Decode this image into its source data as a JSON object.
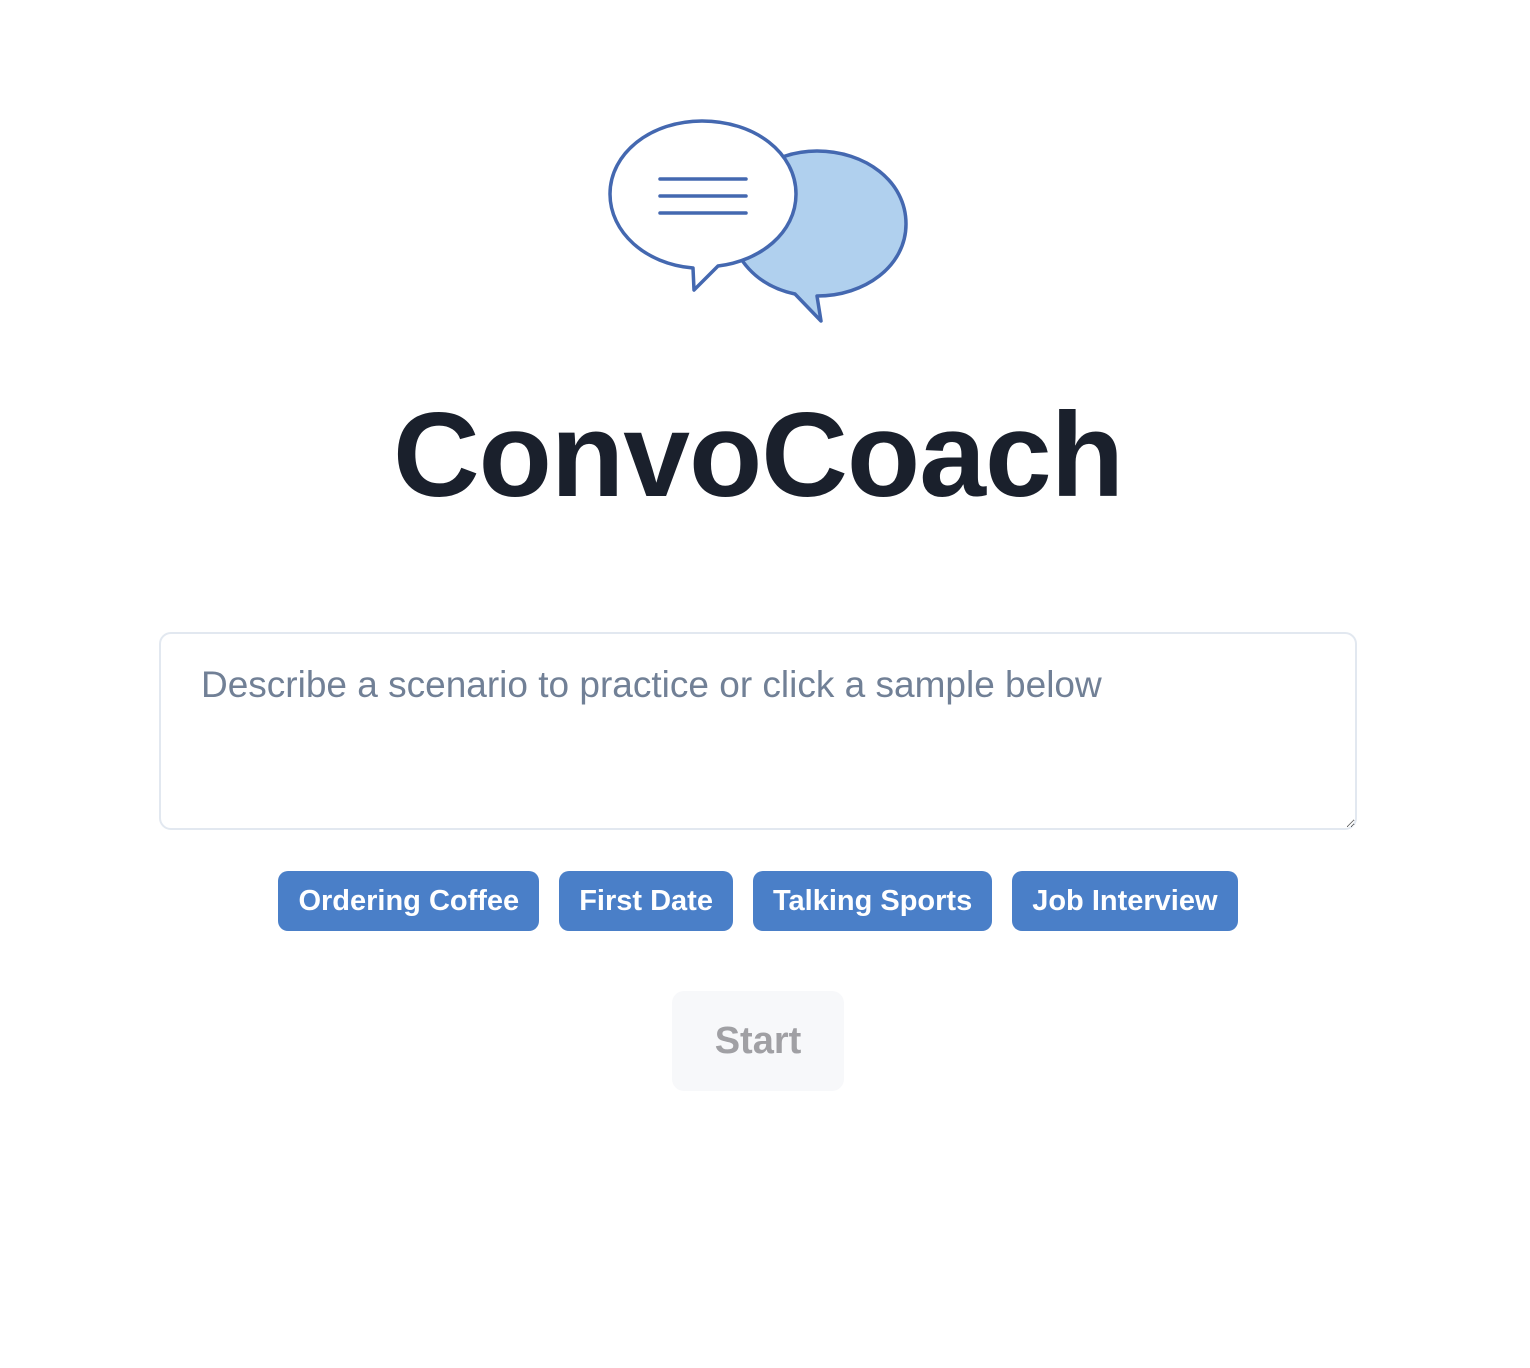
{
  "app": {
    "title": "ConvoCoach",
    "logo_icon": "chat-bubbles-icon",
    "colors": {
      "accent": "#4a7fc8",
      "logo_stroke": "#4468b0",
      "logo_fill": "#b0d0ee",
      "title_text": "#1a202c"
    }
  },
  "scenario": {
    "value": "",
    "placeholder": "Describe a scenario to practice or click a sample below"
  },
  "samples": [
    {
      "label": "Ordering Coffee"
    },
    {
      "label": "First Date"
    },
    {
      "label": "Talking Sports"
    },
    {
      "label": "Job Interview"
    }
  ],
  "start": {
    "label": "Start",
    "disabled": true
  }
}
